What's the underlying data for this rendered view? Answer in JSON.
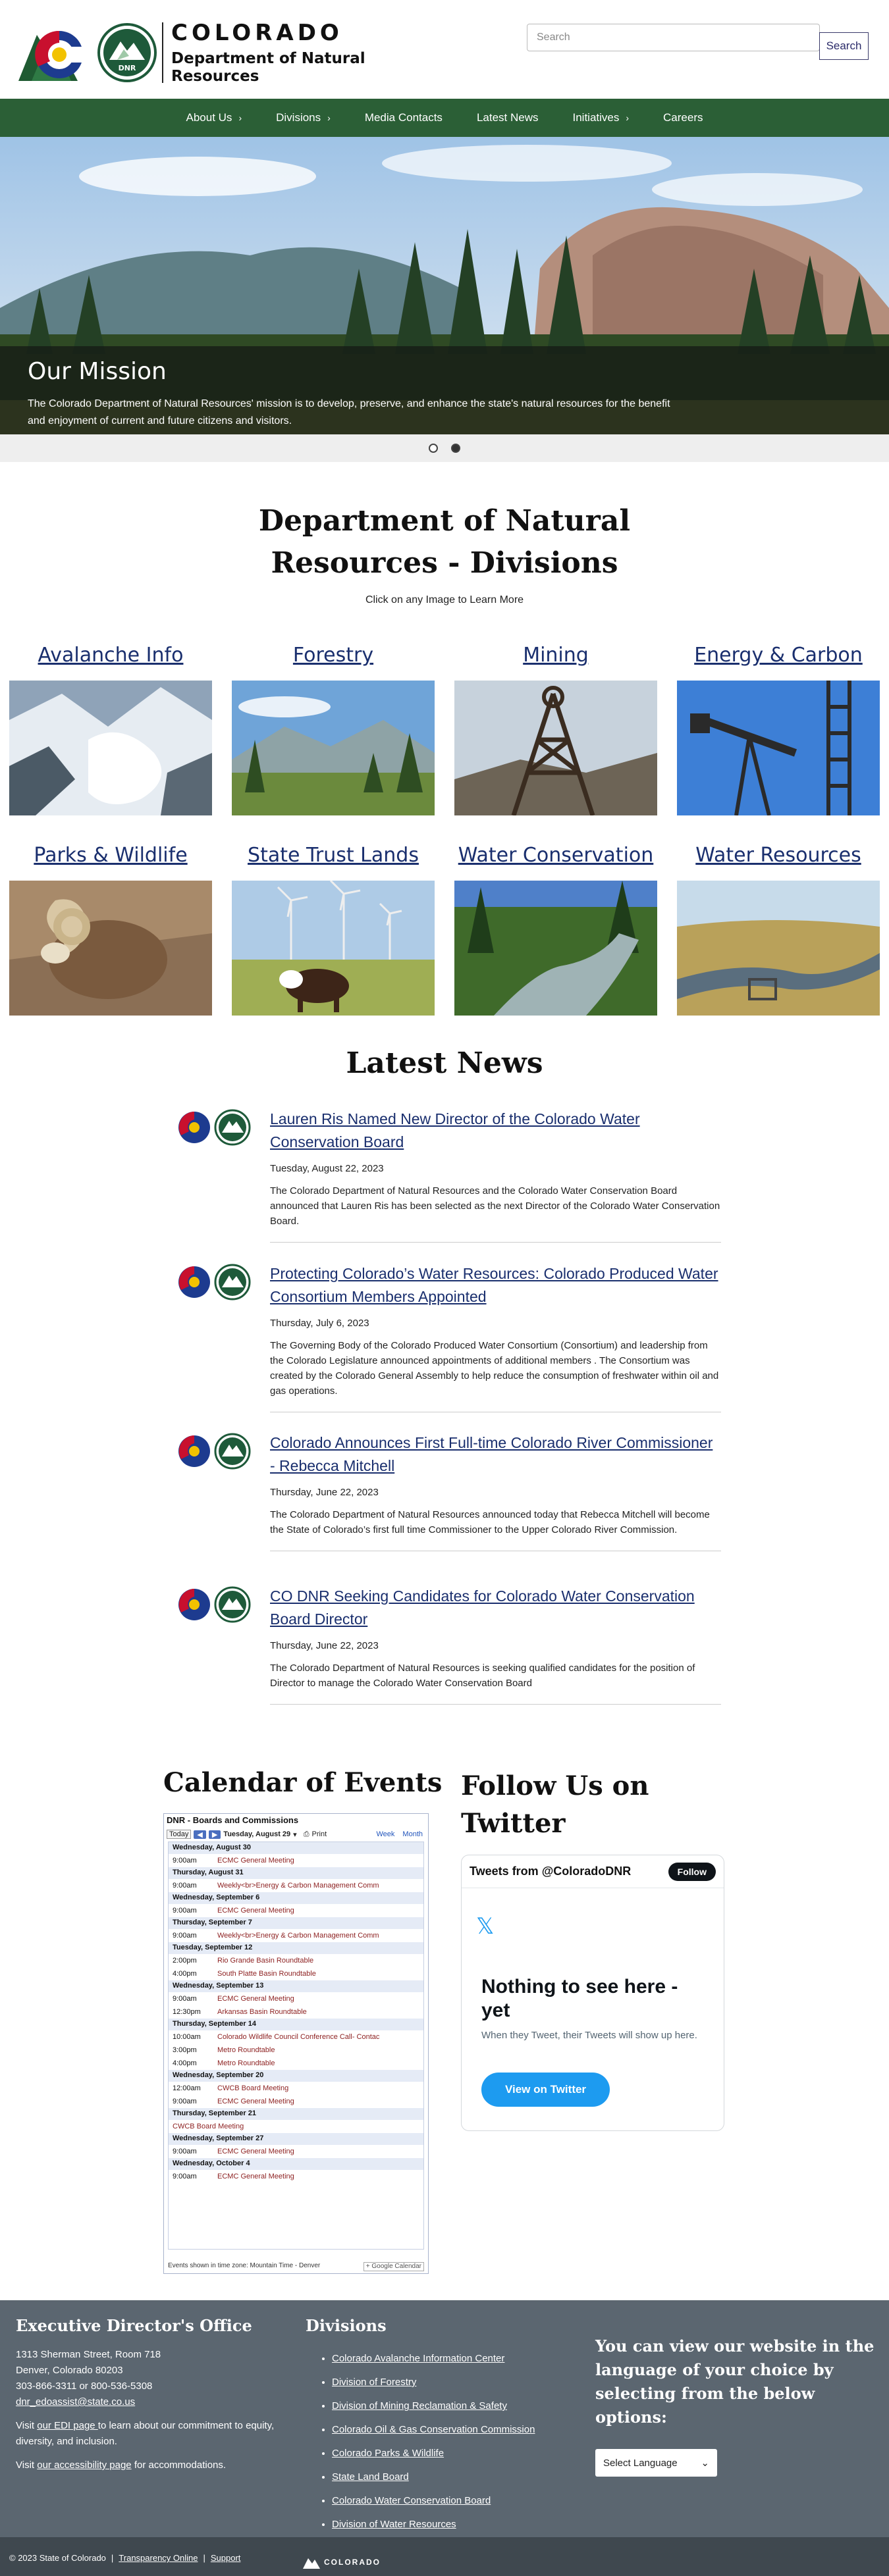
{
  "header": {
    "logo_state": "COLORADO",
    "logo_dept": "Department of Natural Resources",
    "dnr_badge": "DNR",
    "search_placeholder": "Search",
    "search_button": "Search"
  },
  "nav": {
    "items": [
      {
        "label": "About Us",
        "has_submenu": true
      },
      {
        "label": "Divisions",
        "has_submenu": true
      },
      {
        "label": "Media Contacts",
        "has_submenu": false
      },
      {
        "label": "Latest News",
        "has_submenu": false
      },
      {
        "label": "Initiatives",
        "has_submenu": true
      },
      {
        "label": "Careers",
        "has_submenu": false
      }
    ]
  },
  "hero": {
    "title": "Our Mission",
    "text": "The Colorado Department of Natural Resources' mission is to develop, preserve, and enhance the state's natural resources for the benefit and enjoyment of current and future citizens and visitors.",
    "slides": 2,
    "active_slide": 2
  },
  "divisions": {
    "title": "Department of Natural Resources - Divisions",
    "subtitle": "Click on any Image to Learn More",
    "items": [
      {
        "label": "Avalanche Info"
      },
      {
        "label": "Forestry"
      },
      {
        "label": "Mining"
      },
      {
        "label": "Energy & Carbon"
      },
      {
        "label": "Parks & Wildlife"
      },
      {
        "label": "State Trust Lands"
      },
      {
        "label": "Water Conservation"
      },
      {
        "label": "Water Resources"
      }
    ]
  },
  "news": {
    "title": "Latest News",
    "items": [
      {
        "headline": "Lauren Ris Named New Director of the Colorado Water Conservation Board",
        "date": "Tuesday, August 22, 2023",
        "summary": "The Colorado Department of Natural Resources and the Colorado Water Conservation Board announced that Lauren Ris has been selected as the next Director of the Colorado Water Conservation Board."
      },
      {
        "headline": "Protecting Colorado’s Water Resources: Colorado Produced Water Consortium Members Appointed",
        "date": "Thursday, July 6, 2023",
        "summary": "The Governing Body of the Colorado Produced Water Consortium (Consortium) and leadership from the Colorado Legislature announced appointments of additional members . The Consortium was created by the Colorado General Assembly to help reduce the consumption of freshwater within oil and gas operations."
      },
      {
        "headline": "Colorado Announces First Full-time Colorado River Commissioner - Rebecca Mitchell",
        "date": "Thursday, June 22, 2023",
        "summary": "The Colorado Department of Natural Resources announced today that Rebecca Mitchell will become the State of Colorado’s first full time Commissioner to the Upper Colorado River Commission."
      },
      {
        "headline": "CO DNR Seeking Candidates for Colorado Water Conservation Board Director",
        "date": "Thursday, June 22, 2023",
        "summary": "The Colorado Department of Natural Resources is seeking qualified candidates for the position of Director to manage the Colorado Water Conservation Board"
      }
    ]
  },
  "calendar": {
    "title": "Calendar of Events",
    "widget_title": "DNR - Boards and Commissions",
    "today_label": "Today",
    "prev": "◀",
    "next": "▶",
    "current": "Tuesday, August 29",
    "print_label": "Print",
    "week_tab": "Week",
    "month_tab": "Month",
    "days": [
      {
        "day": "Wednesday, August 30",
        "events": [
          {
            "time": "9:00am",
            "title": "ECMC General Meeting"
          }
        ]
      },
      {
        "day": "Thursday, August 31",
        "events": [
          {
            "time": "9:00am",
            "title": "Weekly<br>Energy & Carbon Management Comm"
          }
        ]
      },
      {
        "day": "Wednesday, September 6",
        "events": [
          {
            "time": "9:00am",
            "title": "ECMC General Meeting"
          }
        ]
      },
      {
        "day": "Thursday, September 7",
        "events": [
          {
            "time": "9:00am",
            "title": "Weekly<br>Energy & Carbon Management Comm"
          }
        ]
      },
      {
        "day": "Tuesday, September 12",
        "events": [
          {
            "time": "2:00pm",
            "title": "Rio Grande Basin Roundtable"
          },
          {
            "time": "4:00pm",
            "title": "South Platte Basin Roundtable"
          }
        ]
      },
      {
        "day": "Wednesday, September 13",
        "events": [
          {
            "time": "9:00am",
            "title": "ECMC General Meeting"
          },
          {
            "time": "12:30pm",
            "title": "Arkansas Basin Roundtable"
          }
        ]
      },
      {
        "day": "Thursday, September 14",
        "events": [
          {
            "time": "10:00am",
            "title": "Colorado Wildlife Council Conference Call- Contac"
          },
          {
            "time": "3:00pm",
            "title": "Metro Roundtable"
          },
          {
            "time": "4:00pm",
            "title": "Metro Roundtable"
          }
        ]
      },
      {
        "day": "Wednesday, September 20",
        "events": [
          {
            "time": "12:00am",
            "title": "CWCB Board Meeting"
          },
          {
            "time": "9:00am",
            "title": "ECMC General Meeting"
          }
        ]
      },
      {
        "day": "Thursday, September 21",
        "events": [
          {
            "time": "",
            "title": "CWCB Board Meeting"
          }
        ]
      },
      {
        "day": "Wednesday, September 27",
        "events": [
          {
            "time": "9:00am",
            "title": "ECMC General Meeting"
          }
        ]
      },
      {
        "day": "Wednesday, October 4",
        "events": [
          {
            "time": "9:00am",
            "title": "ECMC General Meeting"
          }
        ]
      }
    ],
    "footer_tz": "Events shown in time zone: Mountain Time - Denver",
    "gcal_label": "Google Calendar"
  },
  "twitter": {
    "title": "Follow Us on Twitter",
    "from": "Tweets from @ColoradoDNR",
    "follow": "Follow",
    "x_glyph": "𝕏",
    "heading": "Nothing to see here - yet",
    "text": "When they Tweet, their Tweets will show up here.",
    "button": "View on Twitter"
  },
  "footer": {
    "office_title": "Executive Director's Office",
    "address1": "1313 Sherman Street, Room 718",
    "address2": "Denver, Colorado 80203",
    "phone": "303-866-3311 or 800-536-5308",
    "email": "dnr_edoassist@state.co.us",
    "edi_pre": "Visit ",
    "edi_link": "our EDI page ",
    "edi_post": "to learn about our commitment to equity, diversity, and inclusion.",
    "acc_pre": "Visit ",
    "acc_link": "our accessibility page",
    "acc_post": " for accommodations.",
    "divisions_title": "Divisions",
    "division_links": [
      "Colorado Avalanche Information Center",
      "Division of Forestry",
      "Division of Mining Reclamation & Safety",
      "Colorado Oil & Gas Conservation Commission",
      "Colorado Parks & Wildlife",
      "State Land Board",
      "Colorado Water Conservation Board",
      "Division of Water Resources"
    ],
    "language_text": "You can view our website in the language of your choice by selecting from the below options:",
    "language_select": "Select Language"
  },
  "bottom": {
    "copyright": "© 2023 State of Colorado",
    "transparency": "Transparency Online",
    "support": "Support",
    "logo_text": "COLORADO"
  },
  "colors": {
    "nav_green": "#2b5f36",
    "link_blue": "#1a2f6e",
    "footer_gray": "#5b6670",
    "twitter_blue": "#1d9bf0"
  }
}
